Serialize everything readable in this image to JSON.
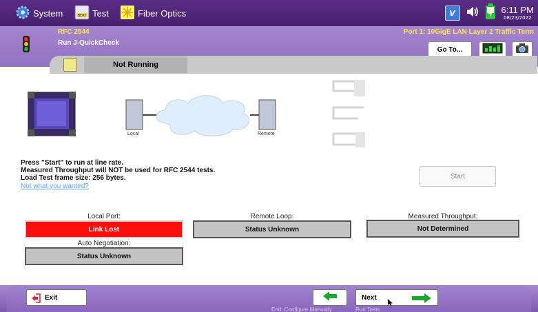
{
  "topbar": {
    "system_label": "System",
    "test_label": "Test",
    "fiber_label": "Fiber Optics",
    "test_icon_text": "BERT",
    "vm_badge": "V",
    "time": "6:11 PM",
    "date": "08/23/2022"
  },
  "header": {
    "test_name": "RFC 2544",
    "port_info": "Port 1: 10GigE LAN Layer 2 Traffic Term",
    "action": "Run J-QuickCheck",
    "goto_label": "Go To..."
  },
  "status_tab": {
    "status": "Not Running"
  },
  "diagram": {
    "local_label": "Local",
    "remote_label": "Remote"
  },
  "message": {
    "line1": "Press \"Start\" to run at line rate.",
    "line2": "Measured Throughput will NOT be used for RFC 2544 tests.",
    "line3": "Load Test frame size: 256 bytes.",
    "link": "Not what you wanted?"
  },
  "start_label": "Start",
  "fields": {
    "local_port": {
      "label": "Local Port:",
      "value": "Link Lost"
    },
    "remote_loop": {
      "label": "Remote Loop:",
      "value": "Status Unknown"
    },
    "throughput": {
      "label": "Measured Throughput:",
      "value": "Not Determined"
    },
    "auto_neg": {
      "label": "Auto Negotiation:",
      "value": "Status Unknown"
    }
  },
  "bottom": {
    "exit_label": "Exit",
    "next_label": "Next",
    "prev_hint": "End: Configure Manually",
    "next_hint": "Run Tests"
  },
  "colors": {
    "topbar": "#4b2375",
    "header": "#9a7ac8",
    "link_lost": "#ff0c0c",
    "accent_yellow": "#ffe34a",
    "arrow_green": "#1aa82a"
  }
}
